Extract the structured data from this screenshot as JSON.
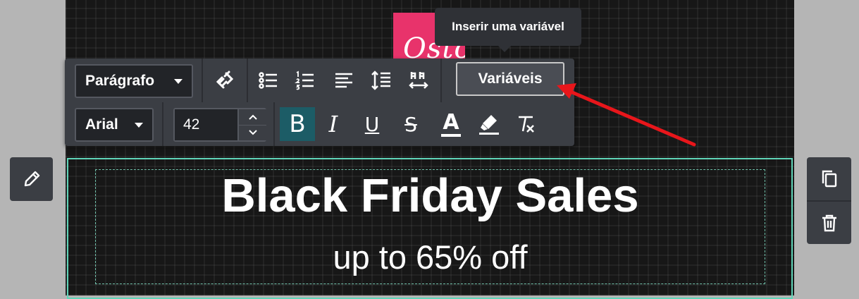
{
  "tooltip": {
    "text": "Inserir uma variável"
  },
  "logo": {
    "text": "Osto"
  },
  "toolbar": {
    "block_type": "Parágrafo",
    "font_family": "Arial",
    "font_size": "42",
    "variables_label": "Variáveis",
    "bold_glyph": "B",
    "italic_glyph": "I",
    "underline_glyph": "U",
    "strike_glyph": "S",
    "color_glyph": "A"
  },
  "content": {
    "headline": "Black Friday Sales",
    "subline": "up to 65% off"
  },
  "colors": {
    "accent_arrow": "#e8161b",
    "logo_bg": "#e8336b",
    "selection": "#5fd4b8",
    "bold_active": "#1c5c66"
  }
}
